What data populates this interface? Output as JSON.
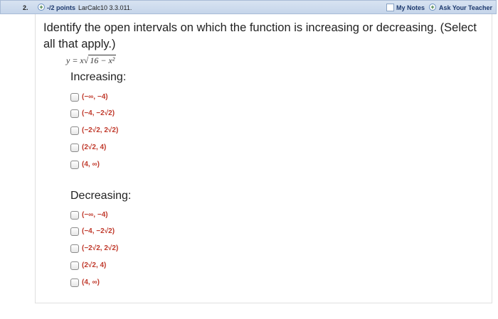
{
  "header": {
    "question_number": "2.",
    "points_label": "-/2 points",
    "problem_code": "LarCalc10 3.3.011.",
    "my_notes": "My Notes",
    "ask_teacher": "Ask Your Teacher"
  },
  "question": {
    "prompt": "Identify the open intervals on which the function is increasing or decreasing. (Select all that apply.)",
    "function_lhs": "y = x",
    "function_radicand": "16 − x²"
  },
  "increasing": {
    "title": "Increasing:",
    "options": [
      "(−∞, −4)",
      "(−4, −2√2)",
      "(−2√2, 2√2)",
      "(2√2, 4)",
      "(4, ∞)"
    ]
  },
  "decreasing": {
    "title": "Decreasing:",
    "options": [
      "(−∞, −4)",
      "(−4, −2√2)",
      "(−2√2, 2√2)",
      "(2√2, 4)",
      "(4, ∞)"
    ]
  },
  "colors": {
    "header_bg": "#c6d5ea",
    "option_text": "#c0392b"
  }
}
